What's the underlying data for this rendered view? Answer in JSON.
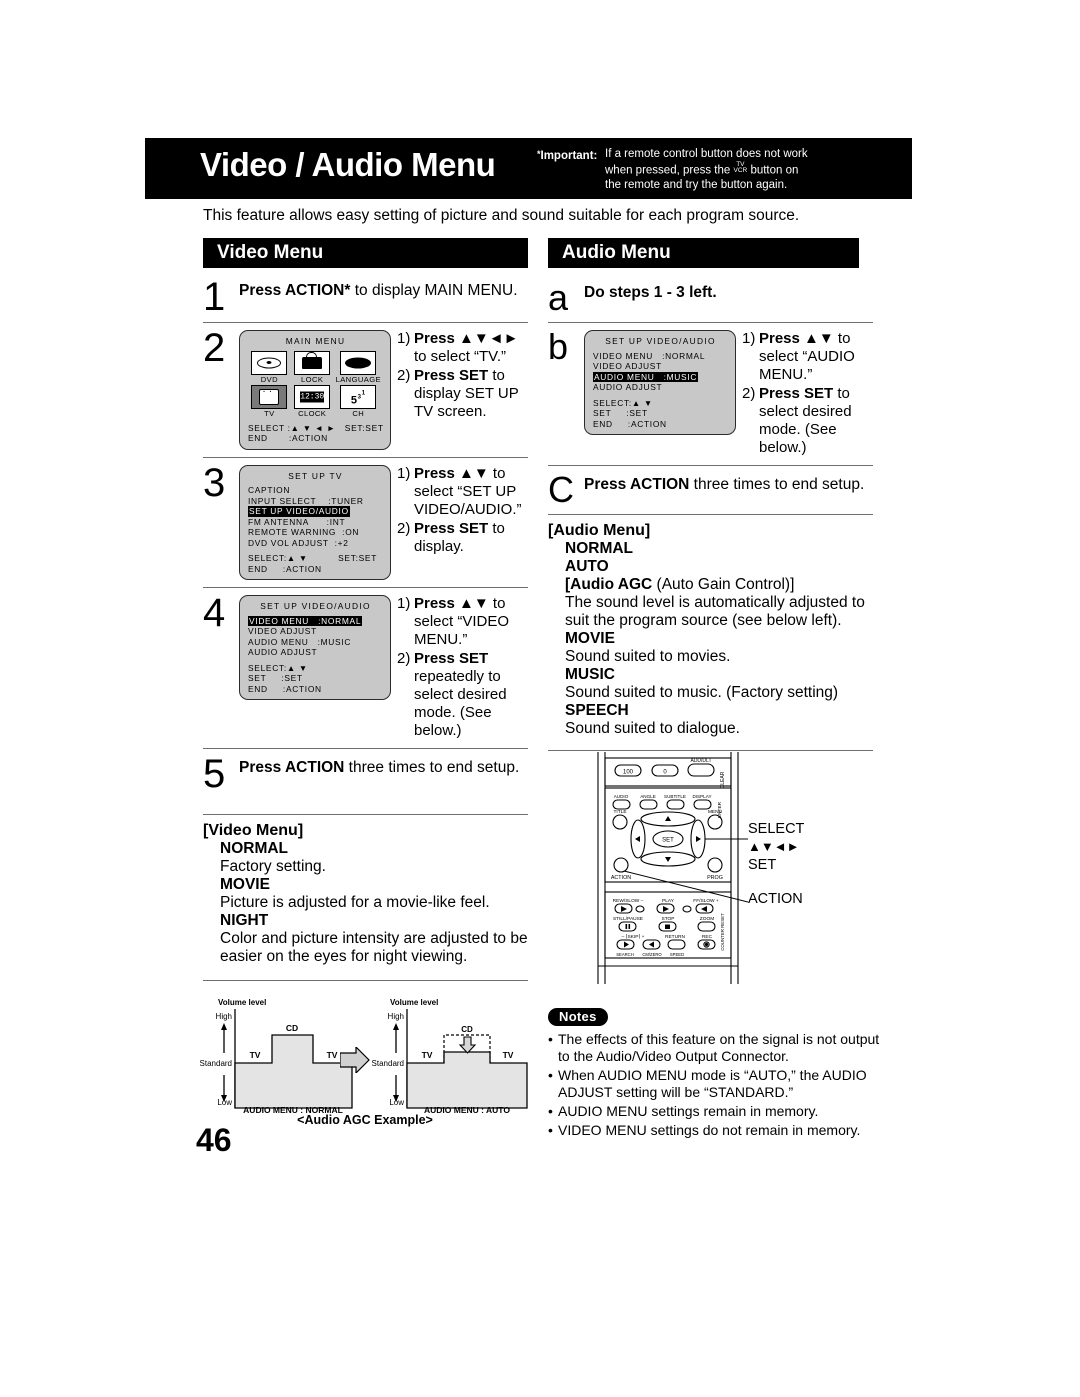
{
  "header": {
    "title": "Video / Audio Menu",
    "important_label": "Important:",
    "important_star": "*",
    "important_text_1": "If a remote control button does not work",
    "important_text_2a": "when pressed, press the",
    "important_tv": "TV",
    "important_vcr": "VCR",
    "important_text_2b": "button on",
    "important_text_3": "the remote and try the button again."
  },
  "intro": "This feature allows easy setting of picture and sound suitable for each program source.",
  "video_section": {
    "bar_title": "Video Menu",
    "step1": {
      "num": "1",
      "text_bold": "Press ACTION*",
      "text_rest": " to display MAIN MENU."
    },
    "step2": {
      "num": "2",
      "screen": {
        "title": "MAIN MENU",
        "icons": [
          {
            "label": "DVD",
            "icon": "disc-icon",
            "selected": false
          },
          {
            "label": "LOCK",
            "icon": "lock-icon",
            "selected": false
          },
          {
            "label": "LANGUAGE",
            "icon": "language-icon",
            "selected": false
          },
          {
            "label": "TV",
            "icon": "tv-icon",
            "selected": true
          },
          {
            "label": "CLOCK",
            "icon": "clock-icon",
            "clock_text": "12:30",
            "selected": false
          },
          {
            "label": "CH",
            "icon": "channel-icon",
            "ch_main": "5",
            "ch_sup1": "3",
            "ch_sup2": "1",
            "selected": false
          }
        ],
        "foot1": "SELECT :▲ ▼ ◄ ►   SET:SET",
        "foot2": "END       :ACTION"
      },
      "instructions": [
        {
          "n": "1)",
          "bold": "Press ▲▼◄►",
          "rest": " to select “TV.”"
        },
        {
          "n": "2)",
          "bold": "Press SET",
          "rest": " to display SET UP TV screen."
        }
      ]
    },
    "step3": {
      "num": "3",
      "screen": {
        "title": "SET UP TV",
        "rows": [
          {
            "text": "CAPTION",
            "selected": false
          },
          {
            "text": "INPUT SELECT    :TUNER",
            "selected": false
          },
          {
            "text": "SET UP VIDEO/AUDIO",
            "selected": true
          },
          {
            "text": "FM ANTENNA      :INT",
            "selected": false
          },
          {
            "text": "REMOTE WARNING  :ON",
            "selected": false
          },
          {
            "text": "DVD VOL ADJUST  :+2",
            "selected": false
          }
        ],
        "foot1": "SELECT:▲ ▼          SET:SET",
        "foot2": "END     :ACTION"
      },
      "instructions": [
        {
          "n": "1)",
          "bold": "Press ▲▼",
          "rest": " to select “SET UP VIDEO/AUDIO.”"
        },
        {
          "n": "2)",
          "bold": "Press SET",
          "rest": " to display."
        }
      ]
    },
    "step4": {
      "num": "4",
      "screen": {
        "title": "SET UP VIDEO/AUDIO",
        "rows": [
          {
            "text": "VIDEO MENU   :NORMAL",
            "selected": true
          },
          {
            "text": "VIDEO ADJUST",
            "selected": false
          },
          {
            "text": "AUDIO MENU   :MUSIC",
            "selected": false
          },
          {
            "text": "AUDIO ADJUST",
            "selected": false
          }
        ],
        "foot1": "SELECT:▲ ▼",
        "foot2": "SET     :SET",
        "foot3": "END     :ACTION"
      },
      "instructions": [
        {
          "n": "1)",
          "bold": "Press ▲▼",
          "rest": " to select “VIDEO MENU.”"
        },
        {
          "n": "2)",
          "bold": "Press SET",
          "rest": " repeatedly to select desired mode. (See below.)"
        }
      ]
    },
    "step5": {
      "num": "5",
      "text_bold": "Press ACTION",
      "text_rest": " three times to end setup."
    },
    "menu_desc": {
      "heading": "[Video Menu]",
      "items": [
        {
          "mode": "NORMAL",
          "text": "Factory setting."
        },
        {
          "mode": "MOVIE",
          "text": "Picture is adjusted for a movie-like feel."
        },
        {
          "mode": "NIGHT",
          "text": "Color and picture intensity are adjusted to be easier on the eyes for night viewing."
        }
      ]
    }
  },
  "audio_section": {
    "bar_title": "Audio Menu",
    "stepa": {
      "num": "a",
      "text_bold": "Do steps 1 - 3 left.",
      "text_rest": ""
    },
    "stepb": {
      "num": "b",
      "screen": {
        "title": "SET UP VIDEO/AUDIO",
        "rows": [
          {
            "text": "VIDEO MENU   :NORMAL",
            "selected": false
          },
          {
            "text": "VIDEO ADJUST",
            "selected": false
          },
          {
            "text": "AUDIO MENU   :MUSIC",
            "selected": true
          },
          {
            "text": "AUDIO ADJUST",
            "selected": false
          }
        ],
        "foot1": "SELECT:▲ ▼",
        "foot2": "SET     :SET",
        "foot3": "END     :ACTION"
      },
      "instructions": [
        {
          "n": "1)",
          "bold": "Press ▲▼",
          "rest": " to select “AUDIO MENU.”"
        },
        {
          "n": "2)",
          "bold": "Press SET",
          "rest": " to select desired mode. (See below.)"
        }
      ]
    },
    "stepc": {
      "num": "C",
      "text_bold": "Press ACTION",
      "text_rest": " three times to end setup."
    },
    "menu_desc": {
      "heading": "[Audio Menu]",
      "items": [
        {
          "mode": "NORMAL",
          "text": ""
        },
        {
          "mode": "AUTO",
          "text": ""
        },
        {
          "mode": "[Audio AGC (Auto Gain Control)]",
          "agc_bold": "[Audio AGC",
          "agc_rest": " (Auto Gain Control)]",
          "text": "The sound level is automatically adjusted to suit the program source (see below left)."
        },
        {
          "mode": "MOVIE",
          "text": "Sound suited to movies."
        },
        {
          "mode": "MUSIC",
          "text": "Sound suited to music. (Factory setting)"
        },
        {
          "mode": "SPEECH",
          "text": "Sound suited to dialogue."
        }
      ]
    }
  },
  "remote": {
    "top_buttons": [
      "100",
      "0",
      "ADD/DLT"
    ],
    "clear_label": "CLEAR",
    "enter_label": "ENTER",
    "row2": [
      "AUDIO",
      "ANGLE",
      "SUBTITLE",
      "DISPLAY"
    ],
    "title_label": "TITLE",
    "menu_label": "MENU",
    "set_label": "SET",
    "action_label": "ACTION",
    "prog_label": "PROG",
    "vcr_row1": [
      "REW/SLOW –",
      "PLAY",
      "FF/SLOW +"
    ],
    "vcr_row2": [
      "STILL/PAUSE",
      "STOP",
      "ZOOM"
    ],
    "vcr_row3": [
      "– ⌈SKIP⌉ +",
      "RETURN",
      "REC"
    ],
    "vcr_row4": [
      "SEARCH",
      "CM/ZERO",
      "SPEED"
    ],
    "counter_label": "COUNTER RESET",
    "callouts": {
      "select": "SELECT",
      "arrows": "▲▼◄►",
      "set": "SET",
      "action": "ACTION"
    }
  },
  "agc_chart": {
    "caption": "<Audio AGC Example>",
    "left": {
      "axis_title": "Volume level",
      "high": "High",
      "standard": "Standard",
      "low": "Low",
      "seg1": "TV",
      "seg2": "CD",
      "seg3": "TV",
      "footer": "AUDIO MENU : NORMAL"
    },
    "right": {
      "axis_title": "Volume level",
      "high": "High",
      "standard": "Standard",
      "low": "Low",
      "seg1": "TV",
      "seg2": "CD",
      "seg3": "TV",
      "footer": "AUDIO MENU : AUTO"
    }
  },
  "notes": {
    "badge": "Notes",
    "items": [
      "The effects of this feature on the signal is not output to the Audio/Video Output Connector.",
      "When AUDIO MENU mode is “AUTO,” the AUDIO ADJUST setting will be “STANDARD.”",
      "AUDIO MENU settings remain in memory.",
      "VIDEO MENU settings do not remain in memory."
    ],
    "bullet": "•"
  },
  "page_number": "46"
}
